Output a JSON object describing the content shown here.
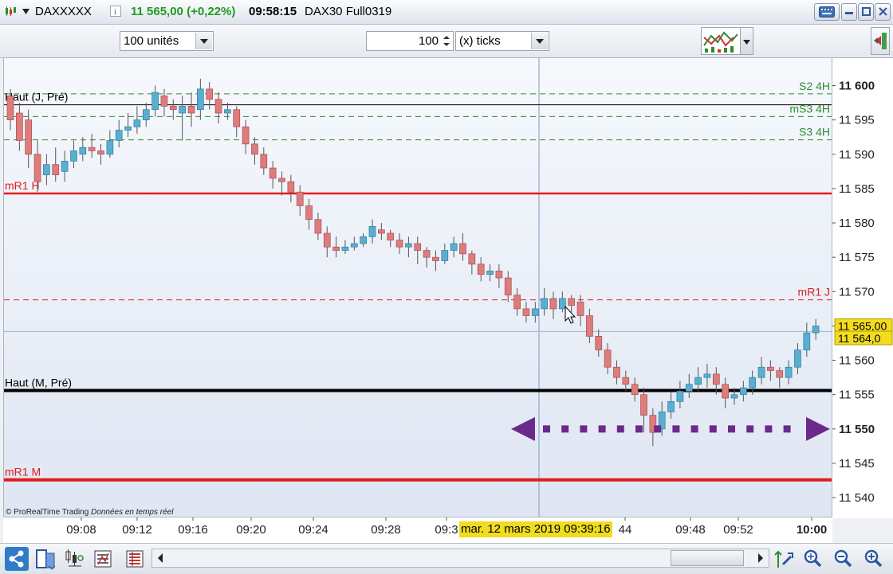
{
  "titlebar": {
    "symbol": "DAXXXXX",
    "price_change": "11 565,00 (+0,22%)",
    "time": "09:58:15",
    "instrument": "DAX30 Full0319"
  },
  "toolbar": {
    "units": "100 unités",
    "ticks_value": "100",
    "ticks_unit": "(x) ticks"
  },
  "colors": {
    "up_candle": "#5aaed0",
    "down_candle": "#dc7c7c",
    "red_level": "#e11b1b",
    "green_level": "#2e8b2e",
    "arrow": "#6a2a8c",
    "last_price_bg": "#f1dc20"
  },
  "levels": [
    {
      "label": "S2 4H",
      "price": 11598.8,
      "style": "green-dashed",
      "side": "right"
    },
    {
      "label": "mS3 4H",
      "price": 11595.5,
      "style": "green-dashed",
      "side": "right"
    },
    {
      "label": "S3 4H",
      "price": 11592.1,
      "style": "green-dashed",
      "side": "right"
    },
    {
      "label": "Haut (J, Pré)",
      "price": 11597.2,
      "style": "black-thin",
      "side": "left"
    },
    {
      "label": "mR1 H",
      "price": 11584.3,
      "style": "red-solid",
      "side": "left"
    },
    {
      "label": "mR1 J",
      "price": 11568.8,
      "style": "red-dashed",
      "side": "right"
    },
    {
      "label": "Haut (M, Pré)",
      "price": 11555.6,
      "style": "black-thick",
      "side": "left"
    },
    {
      "label": "mR1 M",
      "price": 11542.6,
      "style": "red-thick",
      "side": "left"
    }
  ],
  "chart_data": {
    "type": "candlestick",
    "y_range": [
      11537,
      11604
    ],
    "y_ticks": [
      "11 600",
      "11 595",
      "11 590",
      "11 585",
      "11 580",
      "11 575",
      "11 570",
      "11 565",
      "11 560",
      "11 555",
      "11 550",
      "11 545",
      "11 540"
    ],
    "y_tick_values": [
      11600,
      11595,
      11590,
      11585,
      11580,
      11575,
      11570,
      11565,
      11560,
      11555,
      11550,
      11545,
      11540
    ],
    "x_ticks": [
      "09:08",
      "09:12",
      "09:16",
      "09:20",
      "09:24",
      "09:28",
      "09:3",
      "44",
      "09:48",
      "09:52",
      "10:00"
    ],
    "last_price": "11 565,00",
    "cursor_price": "11 564,0",
    "cursor_time": "mar. 12 mars 2019 09:39:16",
    "cursor_price_value": 11564.2,
    "candles": [
      [
        11598.5,
        11595.0,
        11599.5,
        11593.5
      ],
      [
        11596.0,
        11592.0,
        11597.5,
        11590.5
      ],
      [
        11595.0,
        11590.0,
        11596.5,
        11588.0
      ],
      [
        11590.0,
        11586.0,
        11592.0,
        11584.5
      ],
      [
        11587.0,
        11588.5,
        11590.0,
        11585.5
      ],
      [
        11588.5,
        11587.0,
        11591.0,
        11586.0
      ],
      [
        11587.5,
        11589.0,
        11590.5,
        11586.0
      ],
      [
        11589.0,
        11590.5,
        11592.0,
        11588.0
      ],
      [
        11590.0,
        11591.0,
        11592.5,
        11589.0
      ],
      [
        11591.0,
        11590.5,
        11593.0,
        11589.5
      ],
      [
        11590.5,
        11590.0,
        11591.5,
        11588.5
      ],
      [
        11590.0,
        11592.0,
        11593.5,
        11589.5
      ],
      [
        11592.0,
        11593.5,
        11595.0,
        11591.0
      ],
      [
        11593.5,
        11594.0,
        11596.0,
        11592.5
      ],
      [
        11594.0,
        11595.0,
        11597.0,
        11593.0
      ],
      [
        11595.0,
        11596.5,
        11597.5,
        11594.0
      ],
      [
        11596.5,
        11599.0,
        11600.0,
        11595.5
      ],
      [
        11598.5,
        11597.0,
        11599.5,
        11595.5
      ],
      [
        11597.0,
        11596.5,
        11598.0,
        11595.0
      ],
      [
        11596.0,
        11597.0,
        11598.5,
        11592.0
      ],
      [
        11597.0,
        11596.0,
        11599.0,
        11594.0
      ],
      [
        11596.5,
        11599.5,
        11601.0,
        11595.0
      ],
      [
        11599.5,
        11598.0,
        11600.5,
        11596.5
      ],
      [
        11598.0,
        11596.0,
        11599.0,
        11594.5
      ],
      [
        11596.0,
        11596.5,
        11597.5,
        11595.0
      ],
      [
        11596.5,
        11594.0,
        11597.0,
        11592.5
      ],
      [
        11594.0,
        11591.5,
        11595.0,
        11590.0
      ],
      [
        11591.5,
        11590.0,
        11592.5,
        11588.5
      ],
      [
        11590.0,
        11588.0,
        11591.0,
        11587.0
      ],
      [
        11588.0,
        11586.5,
        11589.0,
        11585.0
      ],
      [
        11586.5,
        11586.0,
        11587.5,
        11584.0
      ],
      [
        11586.0,
        11584.5,
        11587.0,
        11583.0
      ],
      [
        11584.5,
        11582.5,
        11585.5,
        11581.0
      ],
      [
        11582.5,
        11580.5,
        11583.5,
        11579.0
      ],
      [
        11580.5,
        11578.5,
        11581.5,
        11577.5
      ],
      [
        11578.5,
        11576.5,
        11579.5,
        11575.0
      ],
      [
        11576.5,
        11576.0,
        11578.0,
        11575.0
      ],
      [
        11576.0,
        11576.5,
        11577.5,
        11575.5
      ],
      [
        11576.5,
        11577.0,
        11578.0,
        11576.0
      ],
      [
        11577.0,
        11578.0,
        11578.5,
        11576.5
      ],
      [
        11578.0,
        11579.5,
        11580.5,
        11577.0
      ],
      [
        11579.0,
        11578.5,
        11580.0,
        11577.5
      ],
      [
        11578.5,
        11577.5,
        11579.0,
        11576.5
      ],
      [
        11577.5,
        11576.5,
        11578.5,
        11575.5
      ],
      [
        11576.5,
        11577.0,
        11578.0,
        11575.0
      ],
      [
        11577.0,
        11576.0,
        11578.0,
        11574.0
      ],
      [
        11576.0,
        11575.0,
        11576.5,
        11573.5
      ],
      [
        11575.0,
        11574.5,
        11576.0,
        11573.0
      ],
      [
        11574.5,
        11576.0,
        11577.0,
        11574.0
      ],
      [
        11576.0,
        11577.0,
        11578.0,
        11575.0
      ],
      [
        11577.0,
        11575.5,
        11578.5,
        11574.5
      ],
      [
        11575.5,
        11574.0,
        11576.0,
        11572.5
      ],
      [
        11574.0,
        11572.5,
        11575.0,
        11571.5
      ],
      [
        11572.5,
        11573.0,
        11574.0,
        11571.5
      ],
      [
        11573.0,
        11572.0,
        11574.0,
        11570.5
      ],
      [
        11572.0,
        11569.5,
        11573.0,
        11568.5
      ],
      [
        11569.5,
        11567.5,
        11570.5,
        11566.5
      ],
      [
        11567.5,
        11566.5,
        11568.5,
        11565.5
      ],
      [
        11566.5,
        11567.5,
        11568.5,
        11565.5
      ],
      [
        11567.5,
        11569.0,
        11570.5,
        11566.5
      ],
      [
        11569.0,
        11567.5,
        11570.0,
        11566.0
      ],
      [
        11567.5,
        11569.0,
        11570.0,
        11567.0
      ],
      [
        11569.0,
        11568.0,
        11569.5,
        11567.0
      ],
      [
        11568.5,
        11566.5,
        11569.5,
        11565.0
      ],
      [
        11566.5,
        11563.5,
        11567.5,
        11562.5
      ],
      [
        11563.5,
        11561.5,
        11564.5,
        11560.5
      ],
      [
        11561.5,
        11559.0,
        11562.5,
        11558.0
      ],
      [
        11559.0,
        11557.5,
        11560.0,
        11556.5
      ],
      [
        11557.5,
        11556.5,
        11558.5,
        11555.5
      ],
      [
        11556.5,
        11555.0,
        11557.5,
        11554.0
      ],
      [
        11555.0,
        11552.0,
        11556.0,
        11549.5
      ],
      [
        11552.0,
        11549.5,
        11553.0,
        11547.5
      ],
      [
        11550.0,
        11552.5,
        11554.0,
        11549.0
      ],
      [
        11552.5,
        11554.0,
        11555.5,
        11551.5
      ],
      [
        11554.0,
        11555.5,
        11557.0,
        11553.0
      ],
      [
        11555.5,
        11556.5,
        11558.0,
        11554.5
      ],
      [
        11556.5,
        11557.5,
        11559.0,
        11555.5
      ],
      [
        11557.5,
        11558.0,
        11559.5,
        11556.0
      ],
      [
        11558.0,
        11556.5,
        11559.0,
        11555.0
      ],
      [
        11556.5,
        11554.5,
        11557.5,
        11553.0
      ],
      [
        11554.5,
        11555.0,
        11556.0,
        11553.5
      ],
      [
        11555.0,
        11556.0,
        11557.0,
        11554.0
      ],
      [
        11556.0,
        11557.5,
        11558.5,
        11555.0
      ],
      [
        11557.5,
        11559.0,
        11560.5,
        11556.5
      ],
      [
        11559.0,
        11558.5,
        11560.0,
        11557.0
      ],
      [
        11558.5,
        11557.5,
        11559.0,
        11556.0
      ],
      [
        11557.5,
        11559.0,
        11560.0,
        11556.5
      ],
      [
        11559.0,
        11561.5,
        11562.5,
        11558.0
      ],
      [
        11561.5,
        11564.0,
        11565.5,
        11560.5
      ],
      [
        11564.0,
        11565.0,
        11566.0,
        11563.0
      ]
    ]
  }
}
